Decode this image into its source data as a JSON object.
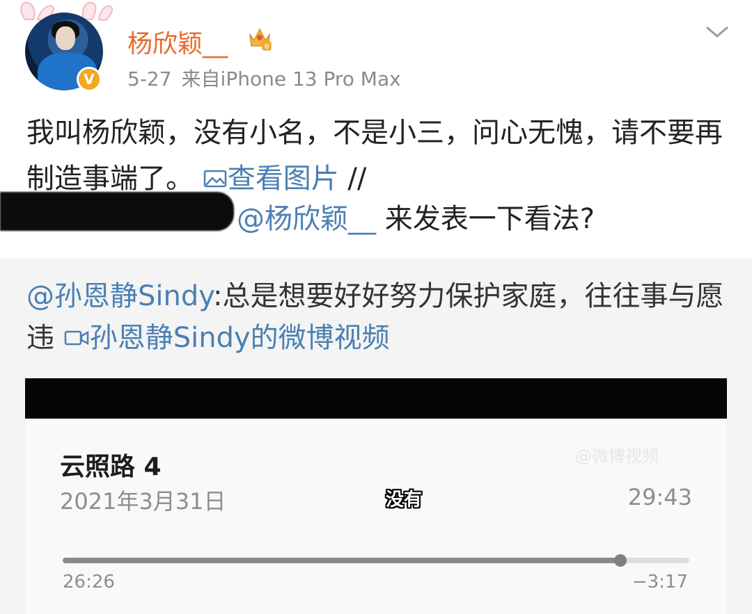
{
  "post": {
    "username": "杨欣颖__",
    "date": "5-27",
    "source": "来自iPhone 13 Pro Max",
    "text_part1": "我叫杨欣颖，没有小名，不是小三，问心无愧，请不要再制造事端了。",
    "view_image_link": "查看图片",
    "slashes": " //",
    "repost_mention": "@杨欣颖__",
    "repost_text": " 来发表一下看法?",
    "avatar_badge": "V",
    "icons": [
      "rabbit-ears-icon",
      "crown-icon",
      "verified-icon",
      "chevron-down-icon",
      "image-icon",
      "video-icon"
    ],
    "colors": {
      "username": "#e86a2b",
      "link": "#4b7fb3",
      "meta": "#8a8a8a",
      "badge": "#f2a81d"
    }
  },
  "quote": {
    "mention": "@孙恩静Sindy",
    "text": ":总是想要好好努力保护家庭，往往事与愿违 ",
    "video_link": "孙恩静Sindy的微博视频"
  },
  "recording": {
    "title": "云照路 4",
    "date": "2021年3月31日",
    "duration": "29:43",
    "subtitle": "没有",
    "elapsed": "26:26",
    "remaining": "−3:17",
    "progress": 0.89,
    "watermark": "@微博视频"
  }
}
